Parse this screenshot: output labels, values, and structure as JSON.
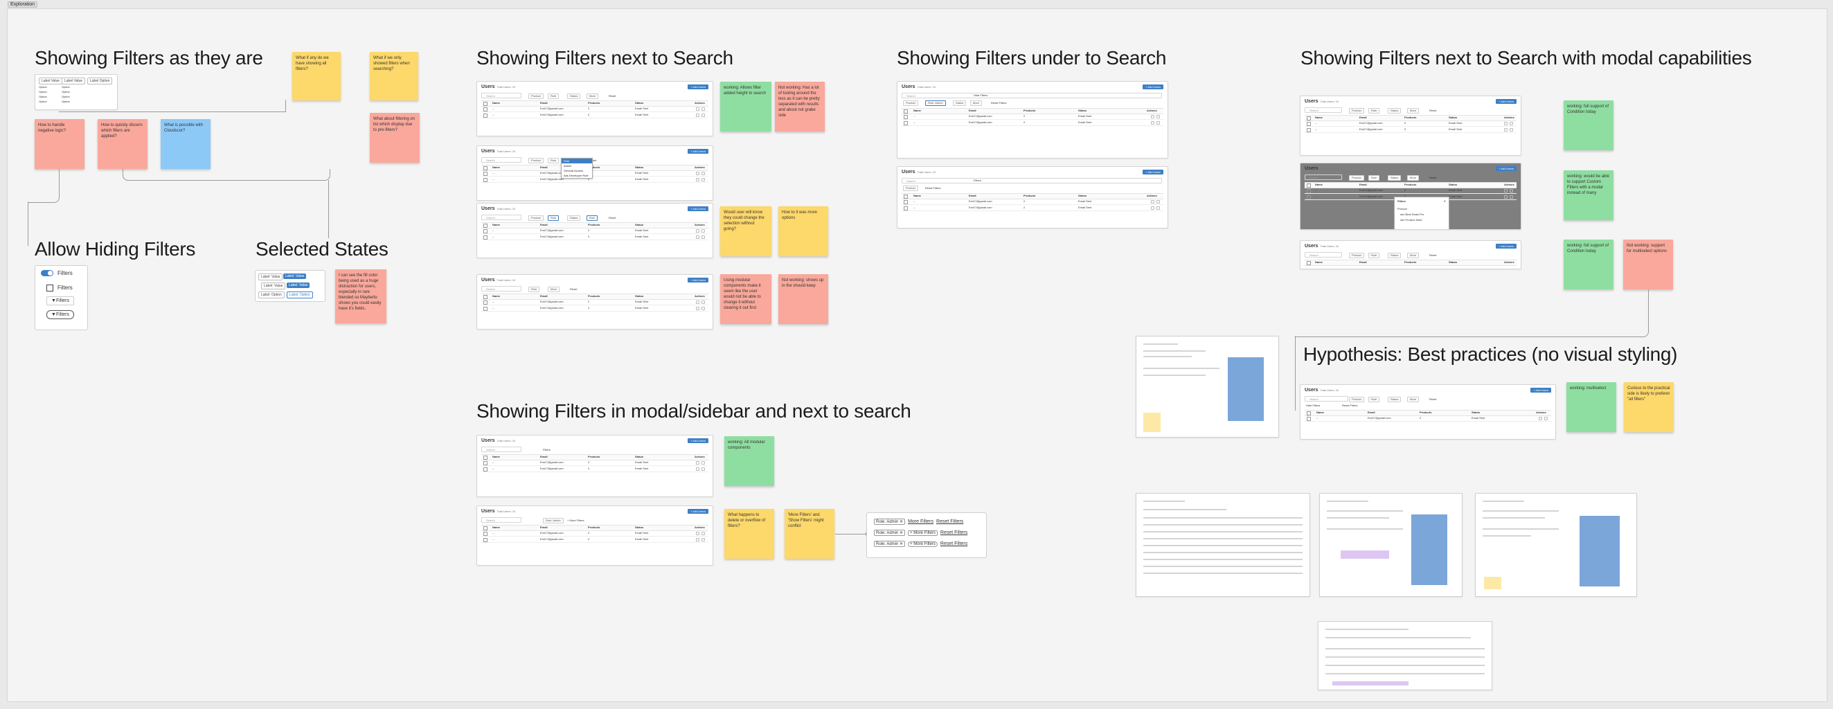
{
  "frame": {
    "label": "Exploration"
  },
  "headings": {
    "as_they_are": "Showing Filters as they are",
    "next_to_search": "Showing Filters next to Search",
    "under_search": "Showing Filters under to Search",
    "modal_capabilities": "Showing Filters next to Search with modal capabilities",
    "allow_hiding": "Allow Hiding Filters",
    "selected_states": "Selected States",
    "modal_sidebar": "Showing Filters in modal/sidebar and next to search",
    "hypothesis": "Hypothesis: Best practices (no visual styling)"
  },
  "table": {
    "title": "Users",
    "total": "Total Users: 10",
    "add_button": "+ Add Users",
    "search_placeholder": "Search",
    "columns": [
      "Name",
      "Email",
      "Products",
      "Status",
      "Actions"
    ],
    "rows": [
      {
        "name": "--",
        "email": "Emi17@gmail.com",
        "products": "2",
        "status": "Email Sent"
      },
      {
        "name": "--",
        "email": "Emi17@gmail.com",
        "products": "2",
        "status": "Email Sent"
      }
    ],
    "filter_labels": {
      "product": "Product",
      "role": "Role",
      "status": "Status",
      "more": "More",
      "reset": "Reset"
    },
    "dropdown_items": [
      "Role",
      "Admin",
      "General Access",
      "Ads Developer Role"
    ],
    "selected_role": "Role: Admin",
    "hide_filters": "Hide Filters",
    "filters_link": "Filters",
    "reset_filters": "Reset Filters",
    "more_filters": "+ More Filters",
    "filters_modal": {
      "title": "Filters",
      "section": "Product",
      "options": [
        "see Best Deals Pro",
        "see Product Suite"
      ]
    }
  },
  "as_they_are_widget": {
    "tabs": [
      "Label Value",
      "Label Value",
      "Label Option"
    ],
    "rows": [
      "Option",
      "Option",
      "Option",
      "Option",
      "Option",
      "Option",
      "Option",
      "Option"
    ]
  },
  "hiding": {
    "items": [
      "Filters",
      "Filters",
      "Filters",
      "Filters"
    ]
  },
  "selected_chips": [
    "Label: Value",
    "Label: Value",
    "Label: Value",
    "Label: Value",
    "Label: Option",
    "Label: Option"
  ],
  "modal_chips": {
    "role": "Role: Admin",
    "more": "More Filters",
    "more2": "+ More Filters",
    "reset": "Reset Filters"
  },
  "stickies": [
    {
      "id": "s1",
      "text": "What if any do we have showing all filters?"
    },
    {
      "id": "s2",
      "text": "What if we only showed filters when searching?"
    },
    {
      "id": "s3",
      "text": "How to handle negative logic?"
    },
    {
      "id": "s4",
      "text": "How to quickly discern which filters are applied?"
    },
    {
      "id": "s5",
      "text": "What is possible with Cloudscor?"
    },
    {
      "id": "s6",
      "text": "What about filtering on list which display due to pre-filters?"
    },
    {
      "id": "s7",
      "text": "working: Allows filter added height to search"
    },
    {
      "id": "s8",
      "text": "Not working: Has a lot of tooling around the less as it can be pretty separated with results and about not grabe side"
    },
    {
      "id": "s9",
      "text": "Would user will know they could change the selection without going?"
    },
    {
      "id": "s10",
      "text": "How to it was more options"
    },
    {
      "id": "s11",
      "text": "Using modular components make it seem like the user would not be able to change it without clearing it out first"
    },
    {
      "id": "s12",
      "text": "Not working: shows up in the should keep"
    },
    {
      "id": "s13",
      "text": "I can see the fill color being used as a huge distraction for users, especially in rare blended so Maybe/to shows you could easily have it's fields."
    },
    {
      "id": "s14",
      "text": "working: All modular components"
    },
    {
      "id": "s15",
      "text": "What happens to delete or overflow of filters?"
    },
    {
      "id": "s16",
      "text": "'More Filters' and 'Show Filters' might conflict"
    },
    {
      "id": "s17",
      "text": "working: full support of Condition today"
    },
    {
      "id": "s18",
      "text": "working: would be able to support Custom Filters with a modal instead of many"
    },
    {
      "id": "s19",
      "text": "working: full support of Condition today"
    },
    {
      "id": "s20",
      "text": "Not working: support for multiselect options"
    },
    {
      "id": "s21",
      "text": "working: multiselect"
    },
    {
      "id": "s22",
      "text": "Curious to the practical side is likely to preferer \"all filters\""
    }
  ],
  "colors": {
    "accent": "#3d7fc6",
    "sticky_yellow": "#fdd86a",
    "sticky_red": "#f9a89b",
    "sticky_green": "#8fdea1",
    "sticky_blue": "#8cc9f7"
  }
}
